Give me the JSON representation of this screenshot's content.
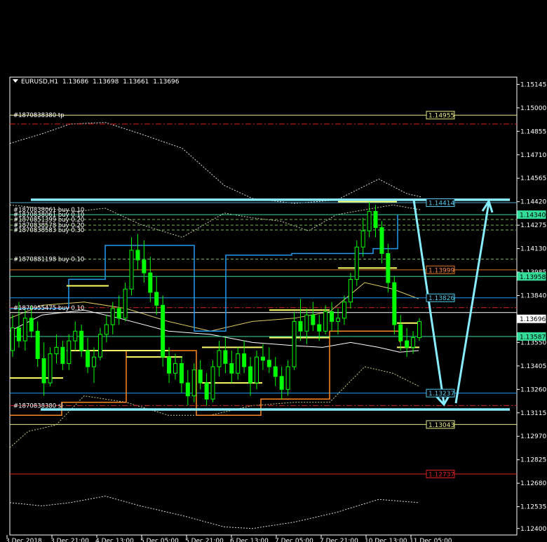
{
  "symbol": "EURUSD,H1",
  "ohlc": [
    "1.13686",
    "1.13698",
    "1.13661",
    "1.13696"
  ],
  "colors": {
    "background": "#000000",
    "axis": "#ffffff",
    "candle_bull": "#00ff00",
    "level_cyan": "#66ddee",
    "level_yellow": "#ffff66",
    "level_red": "#dd2222",
    "level_green": "#33dd99",
    "stairs_blue": "#2299ee",
    "stairs_orange": "#ff8822",
    "arrow": "#88eeff"
  },
  "chart_data": {
    "type": "candlestick",
    "title": "",
    "ylim": [
      1.1236,
      1.1519
    ],
    "y_ticks": [
      "1.15145",
      "1.15000",
      "1.14855",
      "1.14710",
      "1.14565",
      "1.14420",
      "1.14275",
      "1.14130",
      "1.13985",
      "1.13840",
      "1.13695",
      "1.13550",
      "1.13405",
      "1.13260",
      "1.13115",
      "1.12970",
      "1.12825",
      "1.12680",
      "1.12535",
      "1.12400"
    ],
    "x_ticks": [
      "3 Dec 2018",
      "3 Dec 21:00",
      "4 Dec 13:00",
      "5 Dec 05:00",
      "5 Dec 21:00",
      "6 Dec 13:00",
      "7 Dec 05:00",
      "7 Dec 21:00",
      "10 Dec 13:00",
      "11 Dec 05:00"
    ],
    "price_boxes": [
      {
        "label": "1.14955",
        "price": 1.14955,
        "style": "yellow"
      },
      {
        "label": "1.14414",
        "price": 1.14414,
        "style": "cyan"
      },
      {
        "label": "1.14340",
        "price": 1.1434,
        "style": "green-fill"
      },
      {
        "label": "1.13999",
        "price": 1.13999,
        "style": "orange"
      },
      {
        "label": "1.13958",
        "price": 1.13958,
        "style": "green-fill"
      },
      {
        "label": "1.13826",
        "price": 1.13826,
        "style": "cyan"
      },
      {
        "label": "1.13696",
        "price": 1.13696,
        "style": "white-fill"
      },
      {
        "label": "1.13587",
        "price": 1.13587,
        "style": "green-fill"
      },
      {
        "label": "1.13237",
        "price": 1.13237,
        "style": "cyan"
      },
      {
        "label": "1.13043",
        "price": 1.13043,
        "style": "yellow"
      },
      {
        "label": "1.12737",
        "price": 1.12737,
        "style": "red"
      }
    ],
    "order_labels": [
      {
        "text": "#1870838380 tp",
        "price": 1.14955
      },
      {
        "text": "#1870838061 buy 0.10",
        "price": 1.1437
      },
      {
        "text": "#1870838061 buy 0.10",
        "price": 1.1434
      },
      {
        "text": "#1870851399 buy 0.20",
        "price": 1.1431
      },
      {
        "text": "#1870838578 buy 0.20",
        "price": 1.14275
      },
      {
        "text": "#1870838583 buy 0.30",
        "price": 1.14245
      },
      {
        "text": "#1870881198 buy 0.10",
        "price": 1.14065
      },
      {
        "text": "#1870955475 buy 0.10",
        "price": 1.13765
      },
      {
        "text": "#1870838380 sl",
        "price": 1.1316
      }
    ],
    "levels": [
      {
        "price": 1.14955,
        "color": "#e8e88a",
        "dash": "",
        "x1": 14
      },
      {
        "price": 1.149,
        "color": "#dd2222",
        "dash": "8 3 2 3",
        "x1": 14
      },
      {
        "price": 1.14414,
        "color": "#55aacc",
        "dash": "",
        "x1": 14
      },
      {
        "price": 1.1434,
        "color": "#33dd99",
        "dash": "",
        "x1": 14
      },
      {
        "price": 1.1431,
        "color": "#77bb55",
        "dash": "4 3",
        "x1": 14
      },
      {
        "price": 1.14275,
        "color": "#77bb55",
        "dash": "4 3",
        "x1": 14
      },
      {
        "price": 1.14245,
        "color": "#77bb55",
        "dash": "4 3",
        "x1": 14
      },
      {
        "price": 1.14065,
        "color": "#77bb55",
        "dash": "4 3",
        "x1": 14
      },
      {
        "price": 1.13999,
        "color": "#dd7722",
        "dash": "",
        "x1": 14
      },
      {
        "price": 1.13958,
        "color": "#33dd99",
        "dash": "",
        "x1": 14
      },
      {
        "price": 1.13826,
        "color": "#2299ee",
        "dash": "",
        "x1": 14
      },
      {
        "price": 1.13765,
        "color": "#dd2222",
        "dash": "8 3 2 3",
        "x1": 14
      },
      {
        "price": 1.13735,
        "color": "#ffffff",
        "dash": "",
        "x1": 14
      },
      {
        "price": 1.13587,
        "color": "#33dd99",
        "dash": "",
        "x1": 14
      },
      {
        "price": 1.13237,
        "color": "#2299ee",
        "dash": "",
        "x1": 14
      },
      {
        "price": 1.1316,
        "color": "#dd2222",
        "dash": "8 3 2 3",
        "x1": 14
      },
      {
        "price": 1.13043,
        "color": "#e8e88a",
        "dash": "",
        "x1": 14
      },
      {
        "price": 1.12737,
        "color": "#dd2222",
        "dash": "",
        "x1": 14
      }
    ],
    "range_lines": [
      1.14432,
      1.13136
    ],
    "candles": [
      [
        1.135,
        1.1372,
        1.1346,
        1.1364
      ],
      [
        1.1364,
        1.138,
        1.1352,
        1.1356
      ],
      [
        1.1356,
        1.1376,
        1.135,
        1.137
      ],
      [
        1.137,
        1.1378,
        1.1358,
        1.1362
      ],
      [
        1.1362,
        1.1368,
        1.134,
        1.1345
      ],
      [
        1.1345,
        1.1355,
        1.1322,
        1.133
      ],
      [
        1.133,
        1.1352,
        1.1328,
        1.1348
      ],
      [
        1.1348,
        1.136,
        1.1342,
        1.1352
      ],
      [
        1.1352,
        1.1356,
        1.1338,
        1.1342
      ],
      [
        1.1342,
        1.136,
        1.1338,
        1.1356
      ],
      [
        1.1356,
        1.1368,
        1.135,
        1.1362
      ],
      [
        1.1362,
        1.1366,
        1.1346,
        1.135
      ],
      [
        1.135,
        1.1358,
        1.1336,
        1.134
      ],
      [
        1.134,
        1.1352,
        1.133,
        1.1346
      ],
      [
        1.1346,
        1.1364,
        1.1344,
        1.136
      ],
      [
        1.136,
        1.1372,
        1.1355,
        1.1366
      ],
      [
        1.1366,
        1.138,
        1.136,
        1.1376
      ],
      [
        1.1376,
        1.1384,
        1.1366,
        1.137
      ],
      [
        1.137,
        1.1392,
        1.1368,
        1.1388
      ],
      [
        1.1388,
        1.142,
        1.1384,
        1.1412
      ],
      [
        1.1412,
        1.1422,
        1.14,
        1.1406
      ],
      [
        1.1406,
        1.1418,
        1.1392,
        1.1398
      ],
      [
        1.1398,
        1.1408,
        1.138,
        1.1386
      ],
      [
        1.1386,
        1.1396,
        1.1372,
        1.1378
      ],
      [
        1.1378,
        1.1384,
        1.134,
        1.1346
      ],
      [
        1.1346,
        1.1352,
        1.133,
        1.1336
      ],
      [
        1.1336,
        1.1348,
        1.1332,
        1.1342
      ],
      [
        1.1342,
        1.1346,
        1.1324,
        1.133
      ],
      [
        1.133,
        1.1338,
        1.1316,
        1.1322
      ],
      [
        1.1322,
        1.1342,
        1.1318,
        1.1338
      ],
      [
        1.1338,
        1.1344,
        1.1326,
        1.133
      ],
      [
        1.133,
        1.1336,
        1.1316,
        1.132
      ],
      [
        1.132,
        1.1344,
        1.1318,
        1.134
      ],
      [
        1.134,
        1.1356,
        1.1334,
        1.135
      ],
      [
        1.135,
        1.1358,
        1.1336,
        1.1342
      ],
      [
        1.1342,
        1.135,
        1.133,
        1.1336
      ],
      [
        1.1336,
        1.1352,
        1.1332,
        1.1348
      ],
      [
        1.1348,
        1.1356,
        1.1336,
        1.134
      ],
      [
        1.134,
        1.1346,
        1.1322,
        1.133
      ],
      [
        1.133,
        1.135,
        1.1326,
        1.1346
      ],
      [
        1.1346,
        1.1354,
        1.1338,
        1.1344
      ],
      [
        1.1344,
        1.1352,
        1.1336,
        1.134
      ],
      [
        1.134,
        1.1346,
        1.1328,
        1.1334
      ],
      [
        1.1334,
        1.134,
        1.132,
        1.1326
      ],
      [
        1.1326,
        1.1344,
        1.1322,
        1.134
      ],
      [
        1.134,
        1.1374,
        1.1338,
        1.1368
      ],
      [
        1.1368,
        1.1382,
        1.1356,
        1.1362
      ],
      [
        1.1362,
        1.1376,
        1.1354,
        1.1372
      ],
      [
        1.1372,
        1.138,
        1.1362,
        1.1366
      ],
      [
        1.1366,
        1.1372,
        1.1356,
        1.1362
      ],
      [
        1.1362,
        1.1378,
        1.136,
        1.1374
      ],
      [
        1.1374,
        1.138,
        1.1362,
        1.1368
      ],
      [
        1.1368,
        1.1376,
        1.136,
        1.137
      ],
      [
        1.137,
        1.1384,
        1.1366,
        1.138
      ],
      [
        1.138,
        1.1398,
        1.1376,
        1.1394
      ],
      [
        1.1394,
        1.1418,
        1.139,
        1.1414
      ],
      [
        1.1414,
        1.1432,
        1.1408,
        1.1424
      ],
      [
        1.1424,
        1.1442,
        1.142,
        1.1436
      ],
      [
        1.1436,
        1.144,
        1.142,
        1.1426
      ],
      [
        1.1426,
        1.143,
        1.1404,
        1.141
      ],
      [
        1.141,
        1.1416,
        1.1386,
        1.1392
      ],
      [
        1.1392,
        1.1396,
        1.136,
        1.1366
      ],
      [
        1.1366,
        1.1372,
        1.135,
        1.1356
      ],
      [
        1.1356,
        1.1364,
        1.1346,
        1.1352
      ],
      [
        1.1352,
        1.1362,
        1.1348,
        1.1358
      ],
      [
        1.1358,
        1.137,
        1.1356,
        1.1368
      ]
    ]
  }
}
